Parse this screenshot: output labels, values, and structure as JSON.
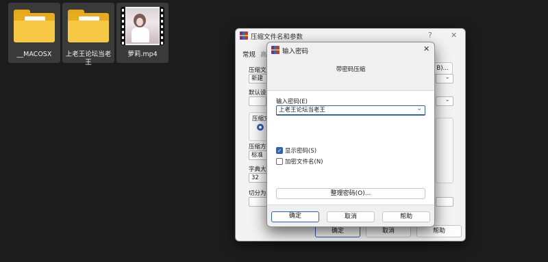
{
  "desktop": {
    "items": [
      {
        "label": "__MACOSX",
        "type": "folder",
        "selected": true
      },
      {
        "label": "上老王论坛当老王",
        "type": "folder",
        "selected": true
      },
      {
        "label": "萝莉.mp4",
        "type": "video",
        "selected": true
      }
    ]
  },
  "back_dialog": {
    "title": "压缩文件名和参数",
    "help_glyph": "?",
    "close_glyph": "✕",
    "tabs": [
      "常规",
      "高"
    ],
    "archive_name_label": "压缩文件",
    "archive_name_value": "新建文",
    "browse_label": "B)...",
    "default_profile_label": "默认设置",
    "format_label": "压缩文",
    "method_label": "压缩方式",
    "method_value": "标准",
    "dict_label": "字典大小",
    "dict_value": "32",
    "split_label": "切分为分",
    "ok_label": "确定",
    "cancel_label": "取消",
    "help_label": "帮助"
  },
  "password_dialog": {
    "title": "输入密码",
    "close_glyph": "✕",
    "header": "带密码压缩",
    "password_label": "输入密码(E)",
    "password_value": "上老王论坛当老王",
    "show_password_label": "显示密码(S)",
    "show_password_checked": true,
    "encrypt_names_label": "加密文件名(N)",
    "encrypt_names_checked": false,
    "organize_label": "整理密码(O)...",
    "ok_label": "确定",
    "cancel_label": "取消",
    "help_label": "帮助"
  },
  "colors": {
    "desktop_bg": "#1c1c1c",
    "accent": "#2c62b8",
    "folder": "#f7c844"
  }
}
